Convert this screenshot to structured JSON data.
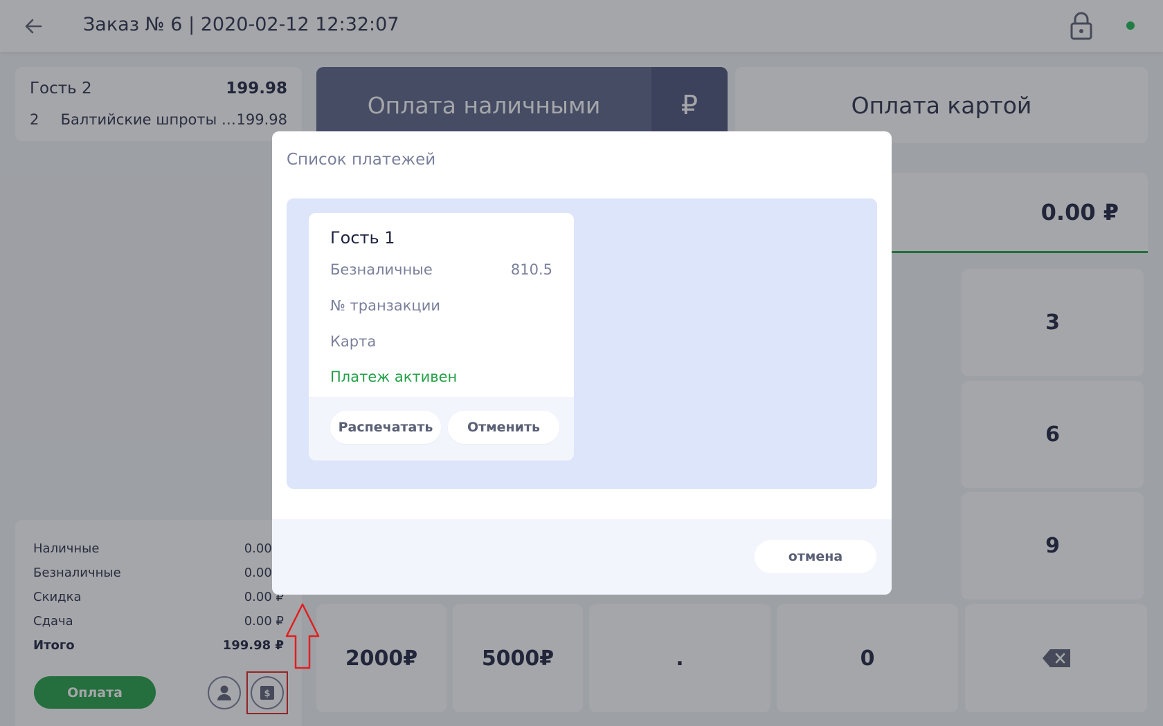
{
  "header": {
    "title": "Заказ № 6 | 2020-02-12 12:32:07",
    "back_icon": "arrow-left-icon",
    "lock_icon": "lock-icon",
    "status_color": "#1db954"
  },
  "order": {
    "guest_name": "Гость 2",
    "guest_total": "199.98",
    "items": [
      {
        "qty": "2",
        "name": "Балтийские шпроты с...",
        "price": "199.98"
      }
    ]
  },
  "summary": {
    "rows": [
      {
        "label": "Наличные",
        "value": "0.00 ₽"
      },
      {
        "label": "Безналичные",
        "value": "0.00 ₽"
      },
      {
        "label": "Скидка",
        "value": "0.00 ₽"
      },
      {
        "label": "Сдача",
        "value": "0.00 ₽"
      },
      {
        "label": "Итого",
        "value": "199.98 ₽"
      }
    ],
    "pay_label": "Оплата",
    "guest_icon": "user-icon",
    "payments_icon": "dollar-receipt-icon"
  },
  "payment": {
    "cash_label": "Оплата наличными",
    "currency": "₽",
    "card_label": "Оплата картой",
    "amount": "0.00 ₽"
  },
  "keypad": {
    "k3": "3",
    "k6": "6",
    "k9": "9",
    "k2000": "2000₽",
    "k5000": "5000₽",
    "kdot": ".",
    "k0": "0",
    "backspace_icon": "backspace-icon"
  },
  "modal": {
    "title": "Список платежей",
    "payment_card": {
      "guest": "Гость 1",
      "type_label": "Безналичные",
      "type_amount": "810.5",
      "transaction_label": "№ транзакции",
      "card_label": "Карта",
      "status": "Платеж активен",
      "print_label": "Распечатать",
      "cancel_label": "Отменить"
    },
    "cancel_label": "отмена"
  },
  "colors": {
    "accent_green": "#22a046",
    "cash_button": "#5a6489",
    "highlight_red": "#e02020"
  }
}
